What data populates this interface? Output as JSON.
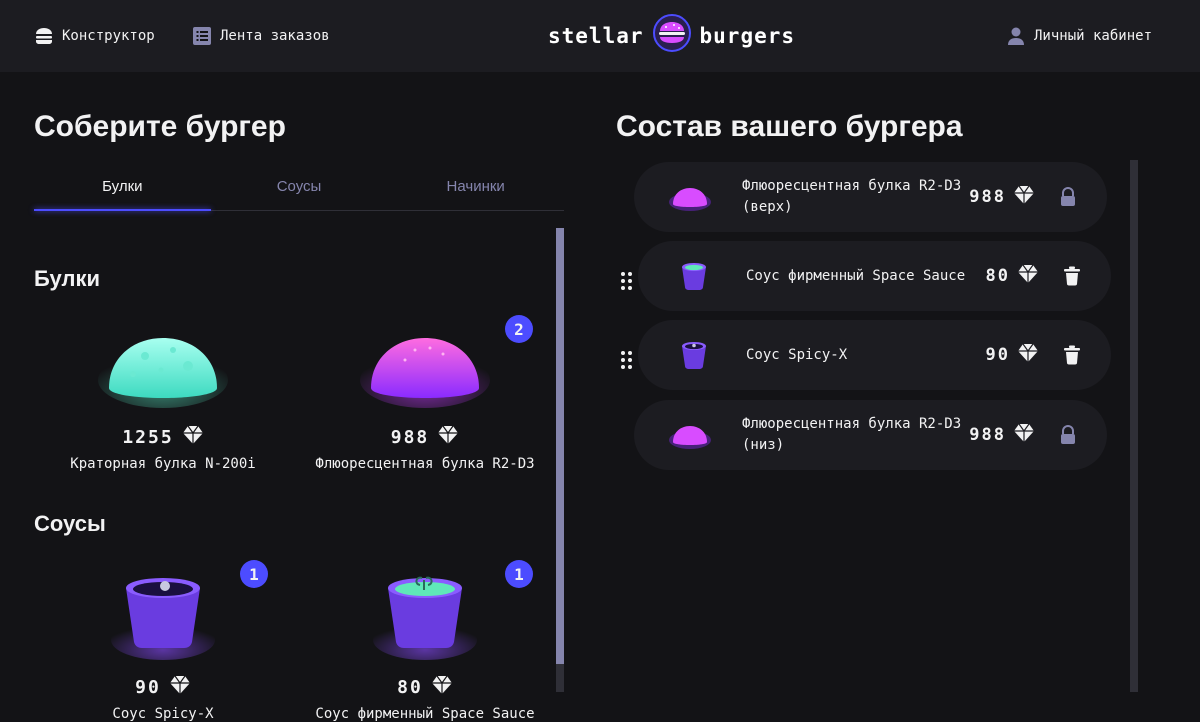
{
  "header": {
    "nav_constructor": "Конструктор",
    "nav_feed": "Лента заказов",
    "logo_left": "stellar",
    "logo_right": "burgers",
    "nav_account": "Личный кабинет"
  },
  "left": {
    "title": "Соберите бургер",
    "tabs": [
      {
        "label": "Булки",
        "active": true
      },
      {
        "label": "Соусы",
        "active": false
      },
      {
        "label": "Начинки",
        "active": false
      }
    ],
    "sections": [
      {
        "title": "Булки",
        "items": [
          {
            "name": "Краторная булка N-200i",
            "price": "1255",
            "count": ""
          },
          {
            "name": "Флюоресцентная булка R2-D3",
            "price": "988",
            "count": "2"
          }
        ]
      },
      {
        "title": "Соусы",
        "items": [
          {
            "name": "Соус Spicy-X",
            "price": "90",
            "count": "1"
          },
          {
            "name": "Соус фирменный Space Sauce",
            "price": "80",
            "count": "1"
          }
        ]
      }
    ]
  },
  "right": {
    "title": "Состав вашего бургера",
    "items": [
      {
        "name": "Флюоресцентная булка R2-D3 (верх)",
        "price": "988",
        "action": "lock-icon"
      },
      {
        "name": "Соус фирменный Space Sauce",
        "price": "80",
        "action": "delete-icon"
      },
      {
        "name": "Соус Spicy-X",
        "price": "90",
        "action": "delete-icon"
      },
      {
        "name": "Флюоресцентная булка R2-D3 (низ)",
        "price": "988",
        "action": "lock-icon"
      }
    ]
  },
  "colors": {
    "accent": "#4c4cff",
    "background": "#131316",
    "panel": "#1c1c21",
    "inactive_text": "#8585ad"
  }
}
